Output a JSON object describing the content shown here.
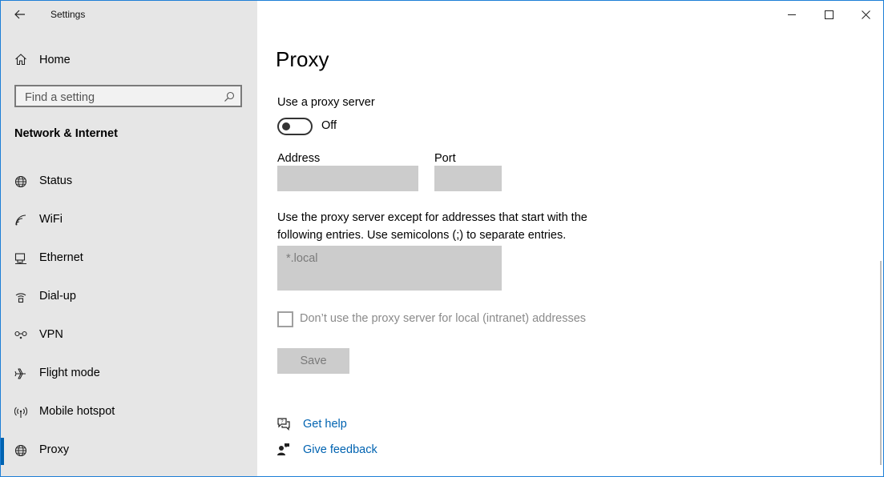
{
  "window": {
    "title": "Settings"
  },
  "sidebar": {
    "home_label": "Home",
    "search_placeholder": "Find a setting",
    "section_title": "Network & Internet",
    "items": [
      {
        "label": "Status",
        "icon": "globe-status-icon",
        "selected": false
      },
      {
        "label": "WiFi",
        "icon": "wifi-icon",
        "selected": false
      },
      {
        "label": "Ethernet",
        "icon": "ethernet-icon",
        "selected": false
      },
      {
        "label": "Dial-up",
        "icon": "dialup-icon",
        "selected": false
      },
      {
        "label": "VPN",
        "icon": "vpn-icon",
        "selected": false
      },
      {
        "label": "Flight mode",
        "icon": "airplane-icon",
        "selected": false
      },
      {
        "label": "Mobile hotspot",
        "icon": "hotspot-icon",
        "selected": false
      },
      {
        "label": "Proxy",
        "icon": "globe-icon",
        "selected": true
      }
    ]
  },
  "content": {
    "page_title": "Proxy",
    "use_proxy_label": "Use a proxy server",
    "toggle_state": "Off",
    "address_label": "Address",
    "address_value": "",
    "port_label": "Port",
    "port_value": "",
    "exceptions_description": "Use the proxy server except for addresses that start with the following entries. Use semicolons (;) to separate entries.",
    "exceptions_value": "*.local",
    "local_checkbox_label": "Don’t use the proxy server for local (intranet) addresses",
    "local_checkbox_checked": false,
    "save_label": "Save",
    "get_help_label": "Get help",
    "give_feedback_label": "Give feedback"
  },
  "colors": {
    "accent": "#0063b1",
    "sidebar_bg": "#e6e6e6",
    "disabled_field": "#cccccc",
    "window_border": "#1e7fd6"
  }
}
